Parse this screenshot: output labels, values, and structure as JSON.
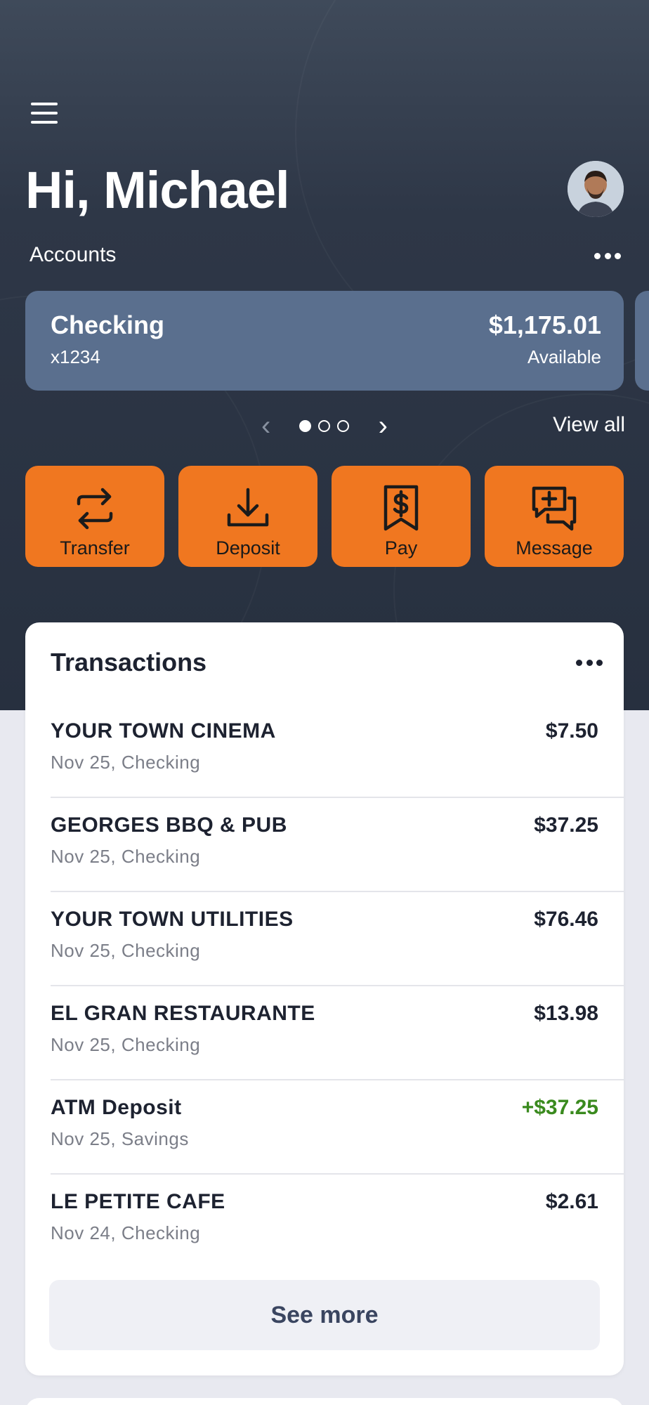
{
  "greeting": "Hi, Michael",
  "accounts": {
    "label": "Accounts",
    "cards": [
      {
        "name": "Checking",
        "number": "x1234",
        "balance": "$1,175.01",
        "balance_label": "Available"
      }
    ],
    "pager": {
      "current": 1,
      "total": 3
    },
    "view_all_label": "View all"
  },
  "actions": [
    {
      "label": "Transfer",
      "icon": "transfer-icon"
    },
    {
      "label": "Deposit",
      "icon": "download-icon"
    },
    {
      "label": "Pay",
      "icon": "receipt-dollar-icon"
    },
    {
      "label": "Message",
      "icon": "message-plus-icon"
    }
  ],
  "transactions": {
    "title": "Transactions",
    "items": [
      {
        "merchant": "YOUR TOWN CINEMA",
        "meta": "Nov 25, Checking",
        "amount": "$7.50"
      },
      {
        "merchant": "GEORGES BBQ & PUB",
        "meta": "Nov 25, Checking",
        "amount": "$37.25"
      },
      {
        "merchant": "YOUR TOWN UTILITIES",
        "meta": "Nov 25, Checking",
        "amount": "$76.46"
      },
      {
        "merchant": "EL GRAN RESTAURANTE",
        "meta": "Nov 25, Checking",
        "amount": "$13.98"
      },
      {
        "merchant": "ATM Deposit",
        "meta": "Nov 25, Savings",
        "amount": "+$37.25"
      },
      {
        "merchant": "LE PETITE CAFE",
        "meta": "Nov 24, Checking",
        "amount": "$2.61"
      }
    ],
    "see_more_label": "See more"
  },
  "colors": {
    "accent": "#f07720",
    "card": "#5a6f8e",
    "credit": "#3a8a1e",
    "hero_bg": "#2e3747"
  }
}
